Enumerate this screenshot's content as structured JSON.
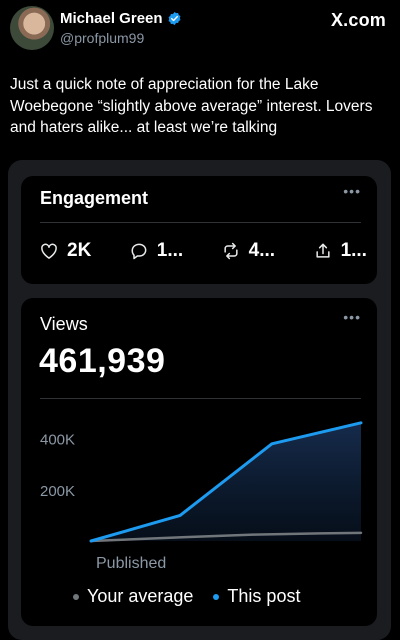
{
  "profile": {
    "name": "Michael Green",
    "handle": "@profplum99",
    "brand": "X.com"
  },
  "post": {
    "text": "Just a quick note of appreciation for the Lake Woebegone “slightly above average” interest. Lovers and haters alike... at least we’re talking"
  },
  "engagement": {
    "title": "Engagement",
    "more_label": "•••",
    "metrics": [
      {
        "icon": "heart-icon",
        "value": "2K"
      },
      {
        "icon": "reply-icon",
        "value": "1..."
      },
      {
        "icon": "repost-icon",
        "value": "4..."
      },
      {
        "icon": "share-icon",
        "value": "1..."
      }
    ]
  },
  "views": {
    "title": "Views",
    "more_label": "•••",
    "count": "461,939"
  },
  "chart_data": {
    "type": "line",
    "ylim": [
      0,
      520000
    ],
    "ytick_labels": [
      "400K",
      "200K"
    ],
    "yticks": [
      400000,
      200000
    ],
    "xlabel": "Published",
    "series": [
      {
        "name": "Your average",
        "color": "#71767b",
        "values": [
          0,
          15000,
          25000,
          30000,
          32000
        ]
      },
      {
        "name": "This post",
        "color": "#1d9bf0",
        "values": [
          0,
          100000,
          380000,
          461939
        ]
      }
    ],
    "series_x": [
      [
        0,
        0.35,
        0.6,
        0.85,
        1.0
      ],
      [
        0,
        0.33,
        0.67,
        1.0
      ]
    ]
  },
  "colors": {
    "accent": "#1d9bf0",
    "muted": "#71767b"
  }
}
